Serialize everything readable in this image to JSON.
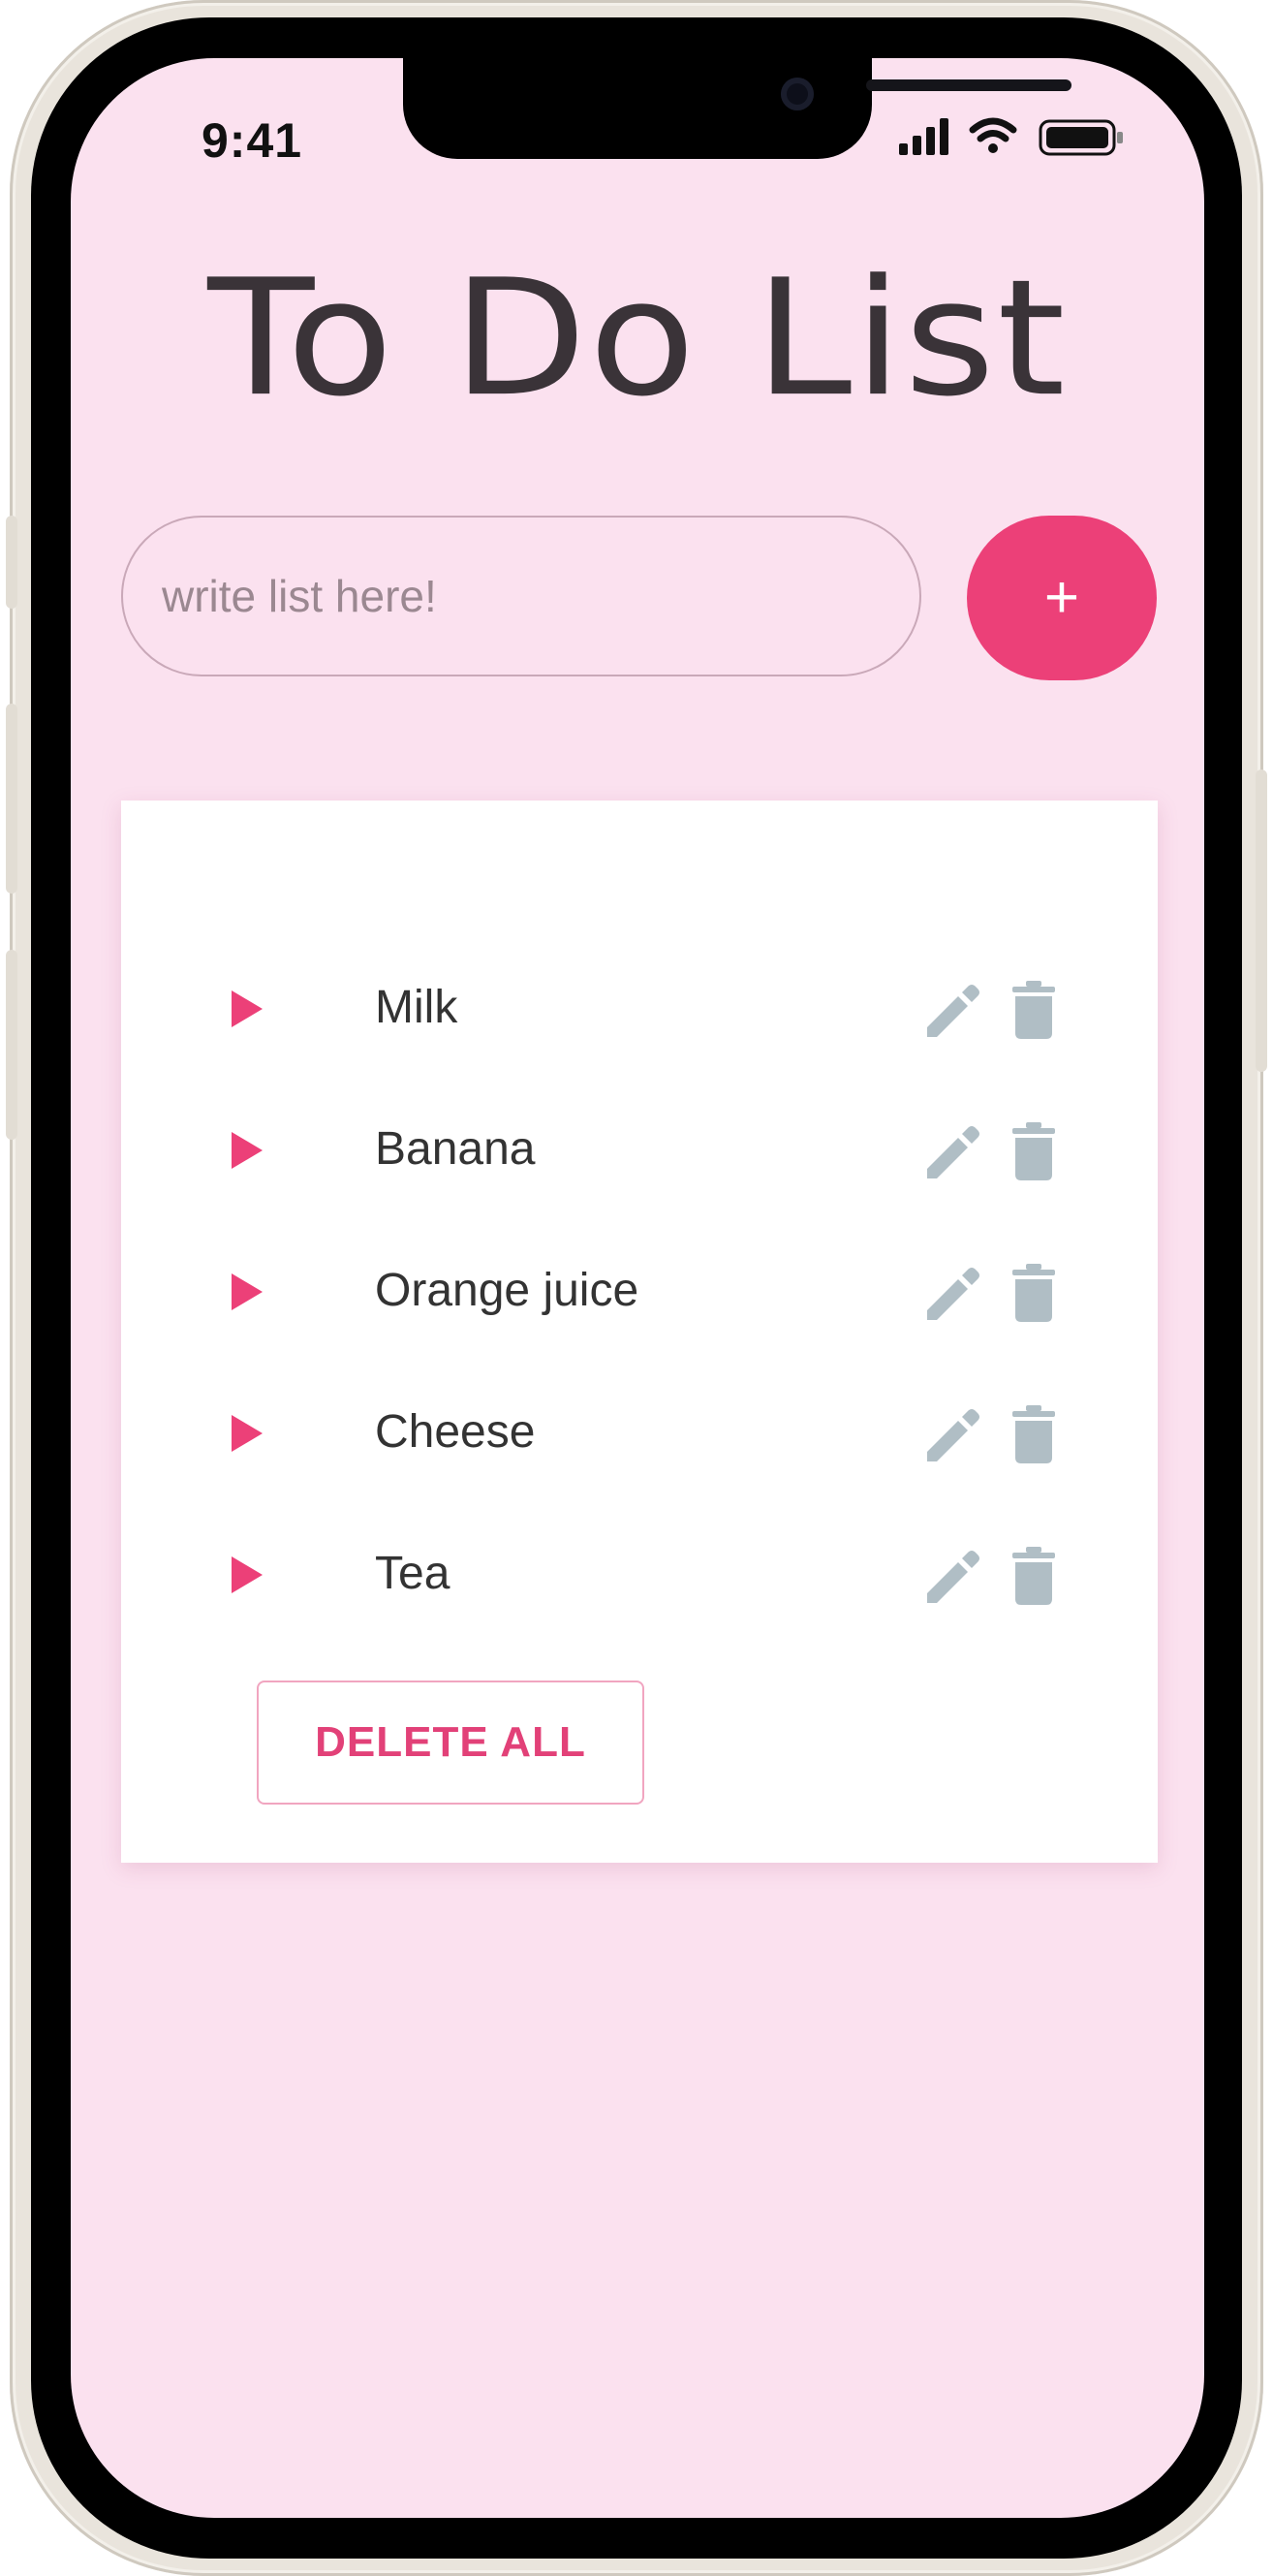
{
  "status_bar": {
    "time": "9:41"
  },
  "header": {
    "title": "To Do List"
  },
  "input": {
    "placeholder": "write list here!",
    "value": ""
  },
  "add_button": {
    "label": "+"
  },
  "list": {
    "items": [
      {
        "label": "Milk"
      },
      {
        "label": "Banana"
      },
      {
        "label": "Orange juice"
      },
      {
        "label": "Cheese"
      },
      {
        "label": "Tea"
      }
    ],
    "delete_all_label": "DELETE ALL"
  },
  "icons": {
    "item_marker": "play-triangle-icon",
    "edit": "pencil-icon",
    "delete": "trash-icon",
    "add": "plus-icon"
  },
  "colors": {
    "accent": "#ec4078",
    "background": "#fbe1ef",
    "icon_gray": "#b0bec5",
    "text": "#333333"
  }
}
